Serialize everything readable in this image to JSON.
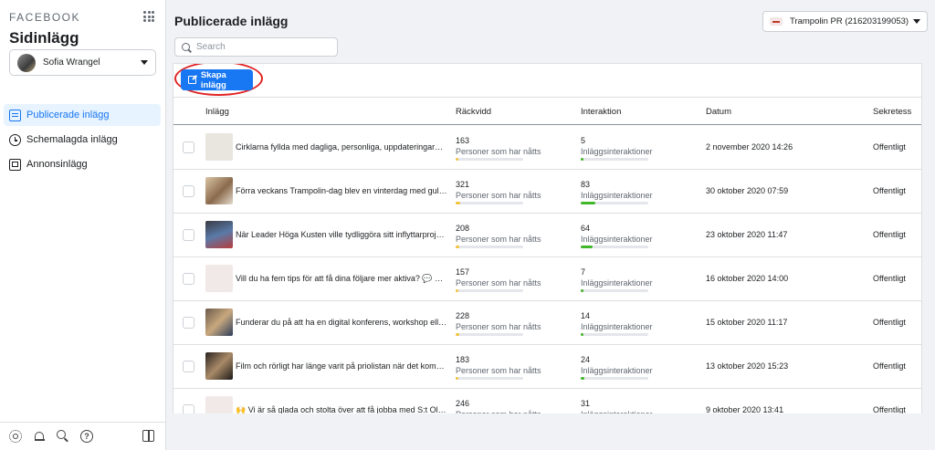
{
  "sidebar": {
    "brand": "FACEBOOK",
    "title": "Sidinlägg",
    "account_name": "Sofia Wrangel",
    "nav": [
      {
        "label": "Publicerade inlägg",
        "icon": "list-icon",
        "active": true
      },
      {
        "label": "Schemalagda inlägg",
        "icon": "clock-icon",
        "active": false
      },
      {
        "label": "Annonsinlägg",
        "icon": "ad-icon",
        "active": false
      }
    ],
    "footer_icons": [
      "settings-icon",
      "bell-icon",
      "search-icon",
      "help-icon",
      "panel-toggle-icon"
    ]
  },
  "header": {
    "title": "Publicerade inlägg",
    "page_selector": "Trampolin PR (216203199053)"
  },
  "search": {
    "placeholder": "Search",
    "value": ""
  },
  "toolbar": {
    "create_label": "Skapa inlägg"
  },
  "table": {
    "columns": [
      "Inlägg",
      "Räckvidd",
      "Interaktion",
      "Datum",
      "Sekretess"
    ],
    "reach_label": "Personer som har nåtts",
    "interaction_label": "Inläggsinteraktioner",
    "rows": [
      {
        "text": "Cirklarna fyllda med dagliga, personliga, uppdateringarna har...",
        "reach": "163",
        "interactions": "5",
        "date": "2 november 2020 14:26",
        "privacy": "Offentligt",
        "reach_fill": 0.04,
        "inter_fill": 0.02,
        "thumb": "t-text"
      },
      {
        "text": "Förra veckans Trampolin-dag blev en vinterdag med guldkan...",
        "reach": "321",
        "interactions": "83",
        "date": "30 oktober 2020 07:59",
        "privacy": "Offentligt",
        "reach_fill": 0.07,
        "inter_fill": 0.22,
        "thumb": "t-food"
      },
      {
        "text": "När Leader Höga Kusten ville tydliggöra sitt inflyttarprojekt L...",
        "reach": "208",
        "interactions": "64",
        "date": "23 oktober 2020 11:47",
        "privacy": "Offentligt",
        "reach_fill": 0.05,
        "inter_fill": 0.17,
        "thumb": "t-people"
      },
      {
        "text": "Vill du ha fem tips för att få dina följare mer aktiva? 💬 Vi fick...",
        "reach": "157",
        "interactions": "7",
        "date": "16 oktober 2020 14:00",
        "privacy": "Offentligt",
        "reach_fill": 0.04,
        "inter_fill": 0.02,
        "thumb": "t-logo"
      },
      {
        "text": "Funderar du på att ha en digital konferens, workshop eller in...",
        "reach": "228",
        "interactions": "14",
        "date": "15 oktober 2020 11:17",
        "privacy": "Offentligt",
        "reach_fill": 0.05,
        "inter_fill": 0.04,
        "thumb": "t-meet"
      },
      {
        "text": "Film och rörligt har länge varit på priolistan när det kommer t...",
        "reach": "183",
        "interactions": "24",
        "date": "13 oktober 2020 15:23",
        "privacy": "Offentligt",
        "reach_fill": 0.04,
        "inter_fill": 0.06,
        "thumb": "t-film"
      },
      {
        "text": "🙌 Vi är så glada och stolta över att få jobba med S:t Olavsle...",
        "reach": "246",
        "interactions": "31",
        "date": "9 oktober 2020 13:41",
        "privacy": "Offentligt",
        "reach_fill": 0.05,
        "inter_fill": 0.08,
        "thumb": "t-logo"
      }
    ]
  },
  "colors": {
    "accent": "#1877f2",
    "reach_bar": "#f5c33b",
    "interaction_bar": "#42b72a",
    "highlight_circle": "#e02424"
  }
}
